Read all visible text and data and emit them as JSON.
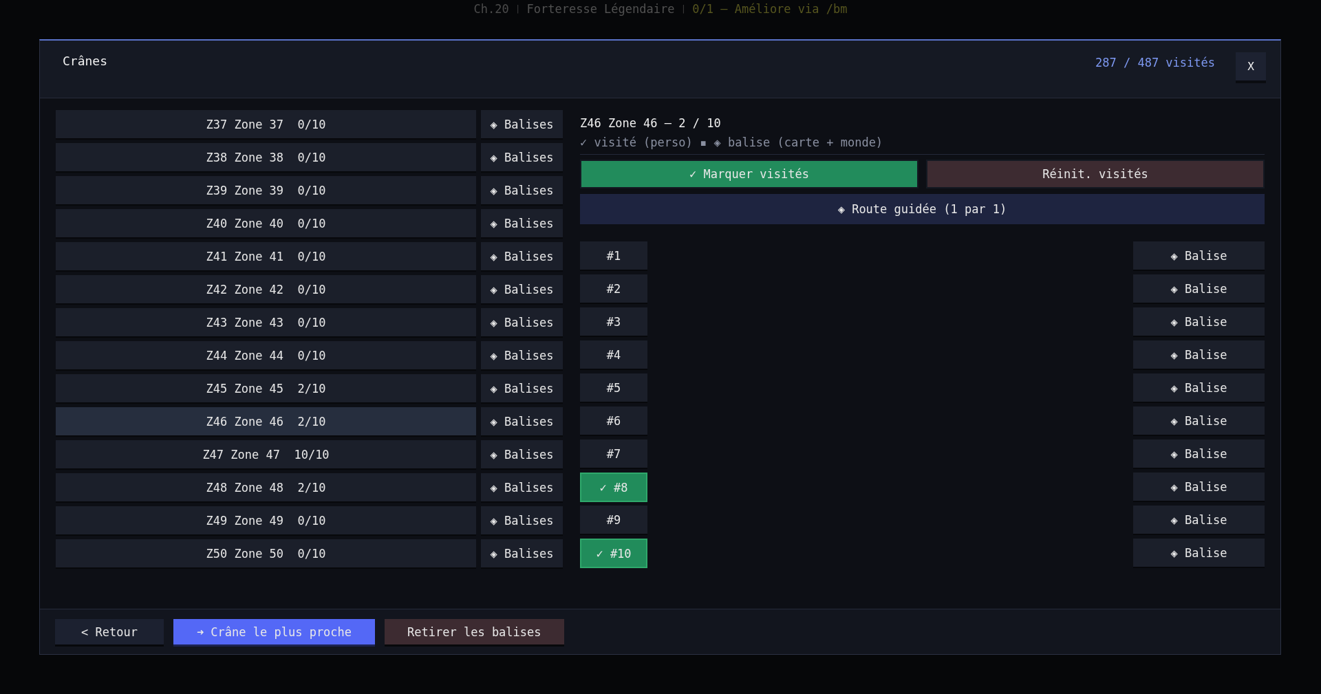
{
  "hud": {
    "segments": [
      {
        "text": "Ch.20",
        "kind": "label",
        "color": "#4b4b4b"
      },
      {
        "text": "|",
        "kind": "divider",
        "color": "#3a3a3a"
      },
      {
        "text": "Forteresse Légendaire",
        "kind": "label",
        "color": "#515151"
      },
      {
        "text": "|",
        "kind": "divider",
        "color": "#3a3a3a"
      },
      {
        "text": "0/1 – Améliore via /bm",
        "kind": "label",
        "color": "#56551f"
      }
    ]
  },
  "dialog": {
    "title": "Crânes",
    "visited_total": "287 / 487 visités",
    "close_button": "X"
  },
  "zones": [
    {
      "label": "Z37 Zone 37  0/10",
      "selected": false,
      "beacons_button": "◈ Balises"
    },
    {
      "label": "Z38 Zone 38  0/10",
      "selected": false,
      "beacons_button": "◈ Balises"
    },
    {
      "label": "Z39 Zone 39  0/10",
      "selected": false,
      "beacons_button": "◈ Balises"
    },
    {
      "label": "Z40 Zone 40  0/10",
      "selected": false,
      "beacons_button": "◈ Balises"
    },
    {
      "label": "Z41 Zone 41  0/10",
      "selected": false,
      "beacons_button": "◈ Balises"
    },
    {
      "label": "Z42 Zone 42  0/10",
      "selected": false,
      "beacons_button": "◈ Balises"
    },
    {
      "label": "Z43 Zone 43  0/10",
      "selected": false,
      "beacons_button": "◈ Balises"
    },
    {
      "label": "Z44 Zone 44  0/10",
      "selected": false,
      "beacons_button": "◈ Balises"
    },
    {
      "label": "Z45 Zone 45  2/10",
      "selected": false,
      "beacons_button": "◈ Balises"
    },
    {
      "label": "Z46 Zone 46  2/10",
      "selected": true,
      "beacons_button": "◈ Balises"
    },
    {
      "label": "Z47 Zone 47  10/10",
      "selected": false,
      "beacons_button": "◈ Balises"
    },
    {
      "label": "Z48 Zone 48  2/10",
      "selected": false,
      "beacons_button": "◈ Balises"
    },
    {
      "label": "Z49 Zone 49  0/10",
      "selected": false,
      "beacons_button": "◈ Balises"
    },
    {
      "label": "Z50 Zone 50  0/10",
      "selected": false,
      "beacons_button": "◈ Balises"
    }
  ],
  "detail": {
    "heading": "Z46 Zone 46 — 2 / 10",
    "legend": "✓ visité (perso) ▪ ◈ balise (carte + monde)",
    "actions": [
      {
        "label": "✓ Marquer visités",
        "kind": "confirm"
      },
      {
        "label": "Réinit. visités",
        "kind": "reset"
      }
    ],
    "route_button": "◈ Route guidée (1 par 1)",
    "skulls": [
      {
        "label": "#1",
        "visited": false,
        "beacon_button": "◈ Balise"
      },
      {
        "label": "#2",
        "visited": false,
        "beacon_button": "◈ Balise"
      },
      {
        "label": "#3",
        "visited": false,
        "beacon_button": "◈ Balise"
      },
      {
        "label": "#4",
        "visited": false,
        "beacon_button": "◈ Balise"
      },
      {
        "label": "#5",
        "visited": false,
        "beacon_button": "◈ Balise"
      },
      {
        "label": "#6",
        "visited": false,
        "beacon_button": "◈ Balise"
      },
      {
        "label": "#7",
        "visited": false,
        "beacon_button": "◈ Balise"
      },
      {
        "label": "✓ #8",
        "visited": true,
        "beacon_button": "◈ Balise"
      },
      {
        "label": "#9",
        "visited": false,
        "beacon_button": "◈ Balise"
      },
      {
        "label": "✓ #10",
        "visited": true,
        "beacon_button": "◈ Balise"
      }
    ]
  },
  "footer": {
    "buttons": [
      {
        "label": "< Retour",
        "kind": "back"
      },
      {
        "label": "➜ Crâne le plus proche",
        "kind": "primary"
      },
      {
        "label": "Retirer les balises",
        "kind": "danger"
      }
    ]
  }
}
